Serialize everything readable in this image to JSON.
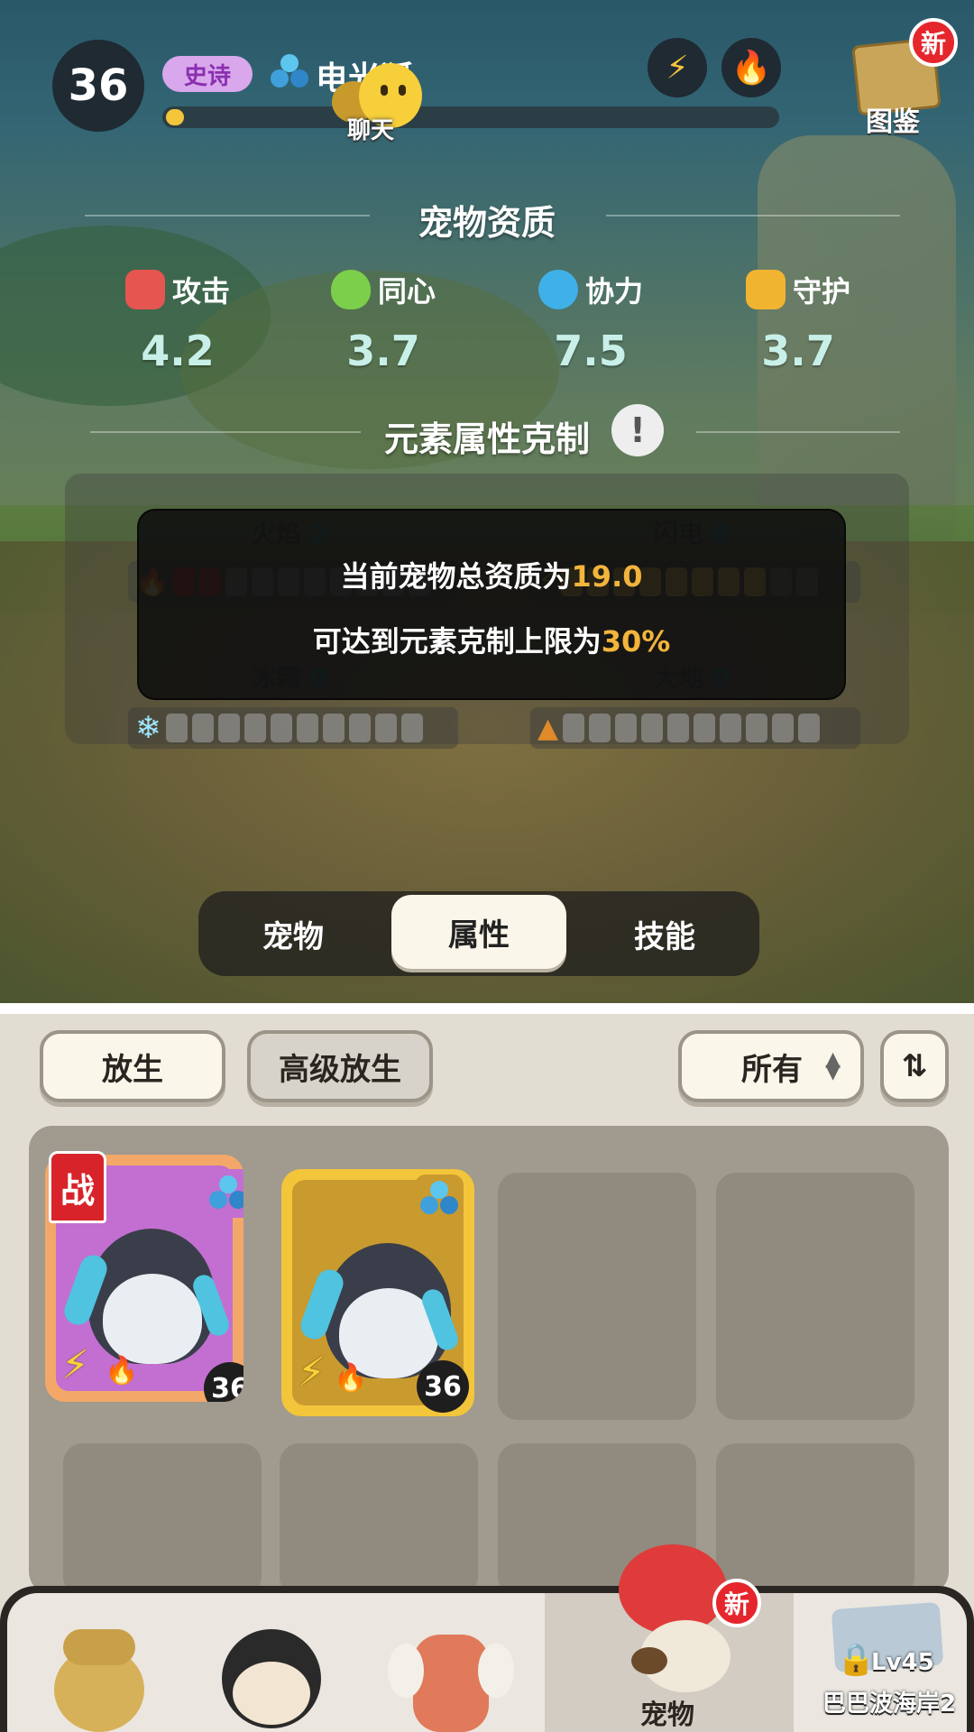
{
  "header": {
    "level": "36",
    "rarity": "史诗",
    "pet_name": "电光狐",
    "xp_progress": 0.03,
    "chat_label": "聊天",
    "atlas_label": "图鉴",
    "atlas_badge": "新",
    "element_buttons": [
      "lightning-icon",
      "fire-icon"
    ]
  },
  "aptitude": {
    "title": "宠物资质",
    "stats": [
      {
        "label": "攻击",
        "value": "4.2",
        "icon": "attack-icon",
        "color": "#e4564f"
      },
      {
        "label": "同心",
        "value": "3.7",
        "icon": "heart-icon",
        "color": "#7ccf4a"
      },
      {
        "label": "协力",
        "value": "7.5",
        "icon": "cooperation-icon",
        "color": "#3fb0e8"
      },
      {
        "label": "守护",
        "value": "3.7",
        "icon": "guard-icon",
        "color": "#f0b431"
      }
    ]
  },
  "elements": {
    "title": "元素属性克制",
    "items": [
      {
        "name": "火焰",
        "value": "2",
        "filled": 2,
        "icon": "fire-icon"
      },
      {
        "name": "闪电",
        "value": "8",
        "filled": 8,
        "icon": "lightning-icon"
      },
      {
        "name": "冰霜",
        "value": "0",
        "filled": 0,
        "icon": "snowflake-icon"
      },
      {
        "name": "大地",
        "value": "0",
        "filled": 0,
        "icon": "mountain-icon"
      }
    ],
    "segments_total": 10
  },
  "tooltip": {
    "line1_prefix": "当前宠物总资质为",
    "line1_value": "19.0",
    "line2_prefix": "可达到元素克制上限为",
    "line2_value": "30%"
  },
  "tabs": [
    {
      "label": "宠物",
      "active": false
    },
    {
      "label": "属性",
      "active": true
    },
    {
      "label": "技能",
      "active": false
    }
  ],
  "actions": {
    "release": "放生",
    "advanced_release": "高级放生",
    "filter_value": "所有",
    "sort_icon": "sort-icon"
  },
  "pets": [
    {
      "level": "36",
      "rarity": "epic",
      "battle": true,
      "battle_tag": "战",
      "frame_color": "#f0a76a",
      "bg_color": "#c56fd3"
    },
    {
      "level": "36",
      "rarity": "legendary",
      "battle": false,
      "frame_color": "#f3c53b",
      "bg_color": "#c99a2e"
    }
  ],
  "nav": {
    "items": [
      "character-a",
      "character-b",
      "character-c",
      "宠物",
      "Lv45"
    ],
    "active_label": "宠物",
    "active_badge": "新",
    "locked_level": "Lv45",
    "locked_name": "巴巴波海岸2"
  }
}
